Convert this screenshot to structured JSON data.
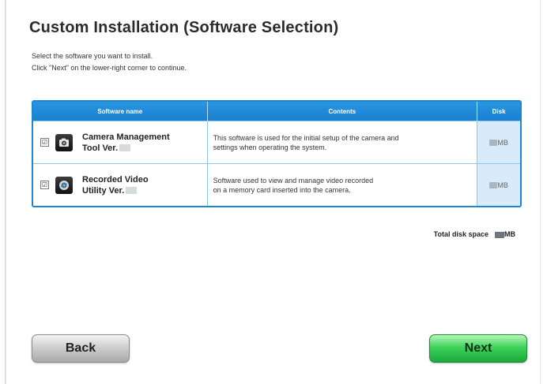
{
  "header": {
    "title": "Custom Installation (Software Selection)",
    "instruction_line1": "Select the software you want to install.",
    "instruction_line2": "Click \"Next\" on the lower-right corner to continue."
  },
  "table": {
    "columns": [
      "Software name",
      "Contents",
      "Disk"
    ],
    "rows": [
      {
        "checked": true,
        "check_glyph": "☑",
        "icon": "camera-icon",
        "name_line1": "Camera Management",
        "name_line2": "Tool Ver.",
        "contents_line1": "This software is used for the initial setup of the camera and",
        "contents_line2": "settings when operating the system.",
        "disk_unit": "MB"
      },
      {
        "checked": true,
        "check_glyph": "☑",
        "icon": "video-disc-icon",
        "name_line1": "Recorded Video",
        "name_line2": "Utility Ver.",
        "contents_line1": "Software used to view and manage video recorded",
        "contents_line2": "on a memory card inserted into the camera.",
        "disk_unit": "MB"
      }
    ]
  },
  "summary": {
    "total_label": "Total disk space",
    "total_unit": "MB"
  },
  "buttons": {
    "back_label": "Back",
    "next_label": "Next"
  },
  "colors": {
    "accent_blue": "#1b86d1",
    "next_green": "#3ed35a",
    "back_gray": "#cfcfcf"
  }
}
